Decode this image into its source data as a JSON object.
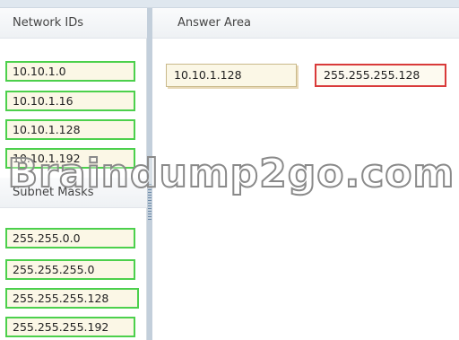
{
  "network_ids": {
    "title": "Network IDs",
    "items": [
      "10.10.1.0",
      "10.10.1.16",
      "10.10.1.128",
      "10.10.1.192"
    ]
  },
  "subnet_masks": {
    "title": "Subnet Masks",
    "items": [
      "255.255.0.0",
      "255.255.255.0",
      "255.255.255.128",
      "255.255.255.192"
    ]
  },
  "answer_area": {
    "title": "Answer Area",
    "network_id": "10.10.1.128",
    "subnet_mask": "255.255.255.128"
  },
  "watermark": "Braindump2go.com",
  "colors": {
    "chip_border": "#4cd04c",
    "chip_fill": "#fbf7e6",
    "selected_mask_border": "#d93a3a",
    "splitter": "#c3cfdb"
  }
}
